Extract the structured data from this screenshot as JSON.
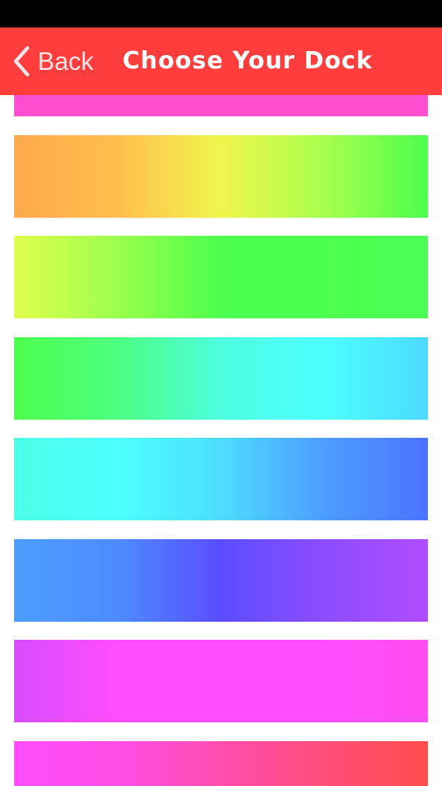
{
  "nav": {
    "back_label": "Back",
    "title": "Choose Your Dock",
    "background": "#ff3d3d"
  },
  "icons": {
    "back": "chevron-left-icon"
  },
  "docks": [
    {
      "colors": [
        "#ff4fd0",
        "#ff4fd0"
      ]
    },
    {
      "colors": [
        "#ffa94d",
        "#ffbe4d",
        "#f0f54d",
        "#a8ff4d",
        "#4dff4d"
      ]
    },
    {
      "colors": [
        "#e0ff4d",
        "#9cff4d",
        "#4dff4d",
        "#4dff4d",
        "#4dff55"
      ]
    },
    {
      "colors": [
        "#4dff4d",
        "#4dff80",
        "#4dffe0",
        "#4dffff",
        "#4dd9ff"
      ]
    },
    {
      "colors": [
        "#4dffe6",
        "#4dffff",
        "#4ddcff",
        "#4d9dff",
        "#4d73ff"
      ]
    },
    {
      "colors": [
        "#4d9dff",
        "#4d8cff",
        "#5a4dff",
        "#8c4dff",
        "#b04dff"
      ]
    },
    {
      "colors": [
        "#d64dff",
        "#ff4dff",
        "#ff4dff",
        "#ff4dff",
        "#ff4df0"
      ]
    },
    {
      "colors": [
        "#ff4dff",
        "#ff4de6",
        "#ff4db0",
        "#ff4d7a",
        "#ff4d4d"
      ]
    }
  ]
}
